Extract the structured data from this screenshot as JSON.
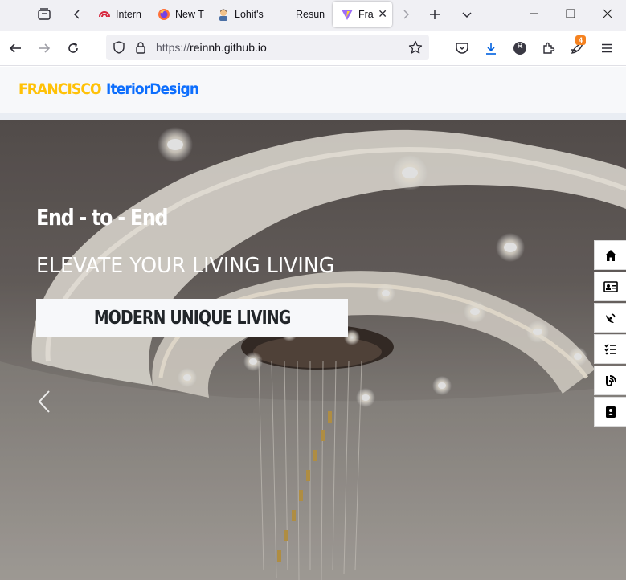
{
  "browser": {
    "tabs": [
      {
        "label": "Intern",
        "icon": "gauge-icon"
      },
      {
        "label": "New T",
        "icon": "firefox-icon"
      },
      {
        "label": "Lohit's",
        "icon": "avatar-emoji-icon"
      },
      {
        "label": "Resun",
        "icon": ""
      },
      {
        "label": "Fra",
        "icon": "vite-icon",
        "active": true
      }
    ],
    "url": {
      "scheme": "https://",
      "host": "reinnh.github.io"
    },
    "notification_count": "4",
    "profile_initial": "R"
  },
  "site": {
    "brand_primary": "FRANCISCO",
    "brand_secondary": "IteriorDesign",
    "brand_primary_color": "#ffc107",
    "brand_secondary_color": "#0d6efd"
  },
  "hero": {
    "subtitle": "End - to - End",
    "title": "ELEVATE YOUR LIVING LIVING",
    "cta_label": "MODERN UNIQUE LIVING"
  },
  "side_nav": [
    {
      "name": "home-icon"
    },
    {
      "name": "id-card-icon"
    },
    {
      "name": "satellite-dish-icon"
    },
    {
      "name": "tasks-list-icon"
    },
    {
      "name": "blog-icon"
    },
    {
      "name": "address-book-icon"
    }
  ]
}
